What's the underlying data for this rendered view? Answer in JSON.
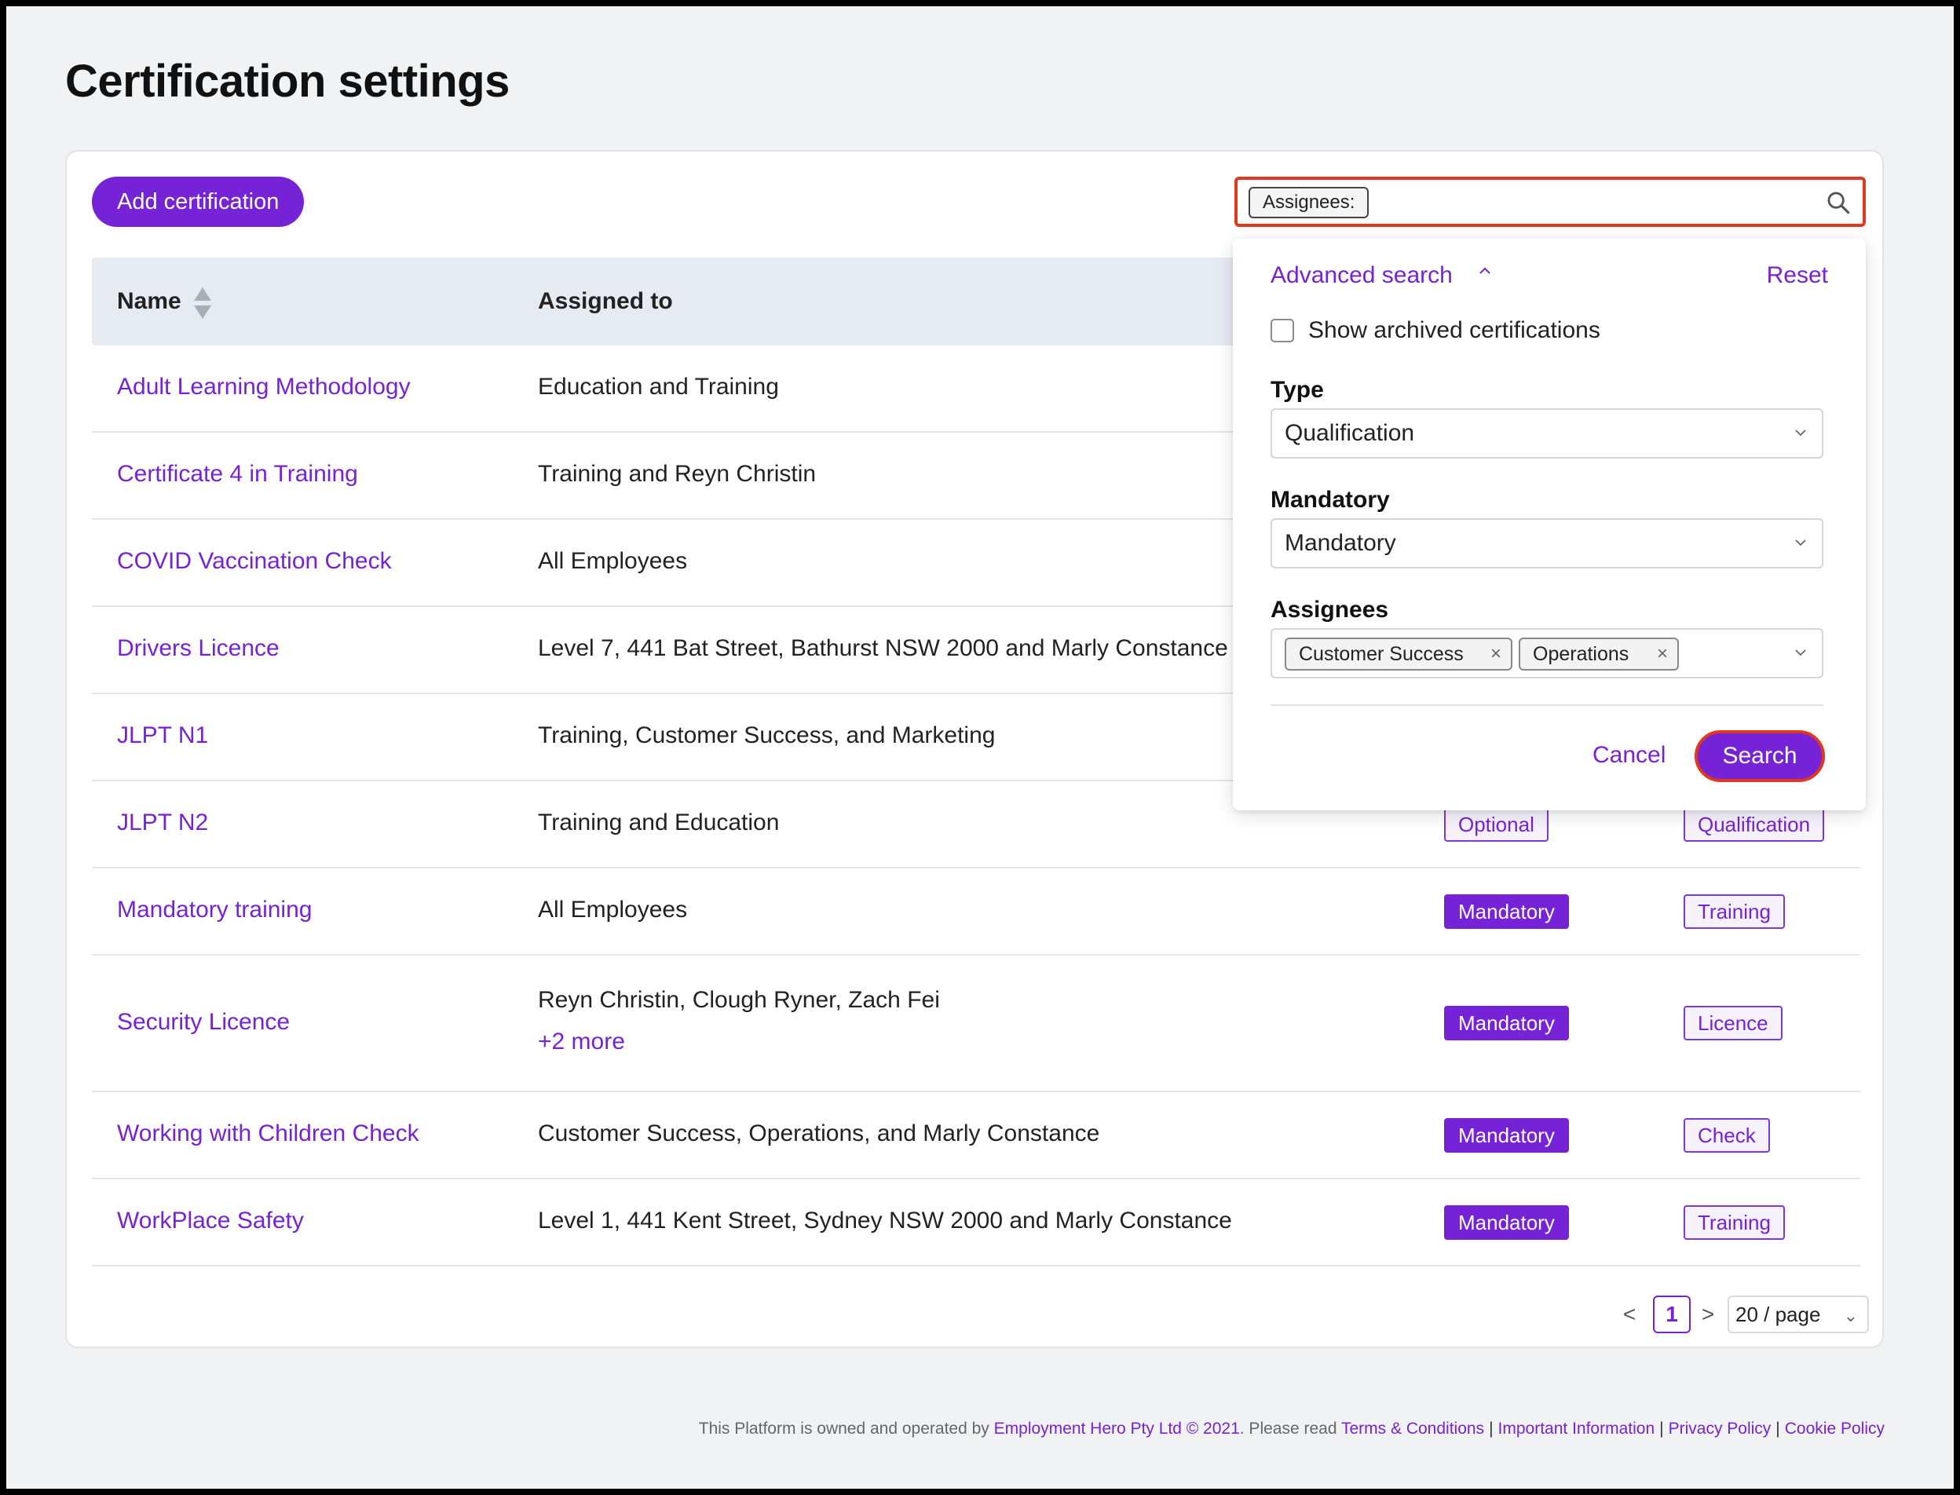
{
  "page": {
    "title": "Certification settings"
  },
  "toolbar": {
    "add_label": "Add certification"
  },
  "search": {
    "tag_label": "Assignees:",
    "value": ""
  },
  "table": {
    "headers": {
      "name": "Name",
      "assigned": "Assigned to"
    },
    "rows": [
      {
        "name": "Adult Learning Methodology",
        "assigned": "Education and Training"
      },
      {
        "name": "Certificate 4 in Training",
        "assigned": "Training and Reyn Christin"
      },
      {
        "name": "COVID Vaccination Check",
        "assigned": "All Employees"
      },
      {
        "name": "Drivers Licence",
        "assigned": "Level 7, 441 Bat Street, Bathurst NSW 2000 and Marly Constance"
      },
      {
        "name": "JLPT N1",
        "assigned": "Training, Customer Success, and Marketing"
      },
      {
        "name": "JLPT N2",
        "assigned": "Training and Education",
        "mandatory": "Optional",
        "type": "Qualification"
      },
      {
        "name": "Mandatory training",
        "assigned": "All Employees",
        "mandatory": "Mandatory",
        "type": "Training"
      },
      {
        "name": "Security Licence",
        "assigned": "Reyn Christin, Clough Ryner, Zach Fei",
        "more": "+2 more",
        "mandatory": "Mandatory",
        "type": "Licence"
      },
      {
        "name": "Working with Children Check",
        "assigned": "Customer Success, Operations, and Marly Constance",
        "mandatory": "Mandatory",
        "type": "Check"
      },
      {
        "name": "WorkPlace Safety",
        "assigned": "Level 1, 441 Kent Street, Sydney NSW 2000 and Marly Constance",
        "mandatory": "Mandatory",
        "type": "Training"
      }
    ]
  },
  "pagination": {
    "prev": "<",
    "current": "1",
    "next": ">",
    "page_size": "20 / page"
  },
  "advanced": {
    "title": "Advanced search",
    "reset": "Reset",
    "show_archived": "Show archived certifications",
    "type_label": "Type",
    "type_value": "Qualification",
    "mandatory_label": "Mandatory",
    "mandatory_value": "Mandatory",
    "assignees_label": "Assignees",
    "assignees": [
      "Customer Success",
      "Operations"
    ],
    "cancel": "Cancel",
    "search": "Search"
  },
  "footer": {
    "prefix": "This Platform is owned and operated by",
    "company": "Employment Hero Pty Ltd © 2021",
    "mid": ". Please read",
    "terms": "Terms & Conditions",
    "info": "Important Information",
    "privacy": "Privacy Policy",
    "cookie": "Cookie Policy"
  },
  "colors": {
    "accent": "#7622d7",
    "highlight": "#e0381e",
    "header_bg": "#e6eaf1",
    "page_bg": "#f1f2f4"
  }
}
